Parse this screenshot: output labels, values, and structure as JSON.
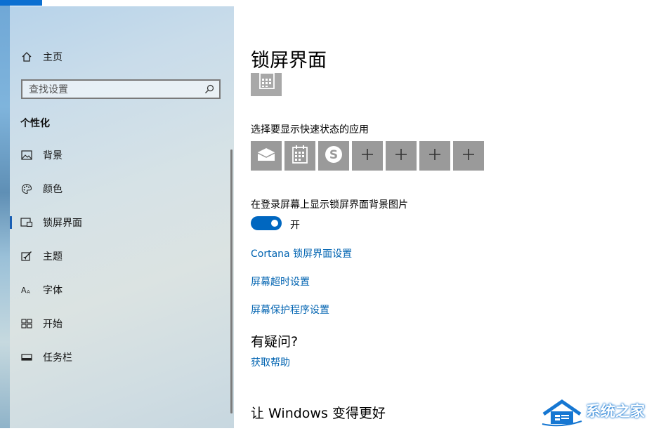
{
  "sidebar": {
    "home_label": "主页",
    "search_placeholder": "查找设置",
    "section_title": "个性化",
    "items": [
      {
        "label": "背景",
        "icon": "picture-icon"
      },
      {
        "label": "颜色",
        "icon": "palette-icon"
      },
      {
        "label": "锁屏界面",
        "icon": "lock-screen-icon",
        "active": true
      },
      {
        "label": "主题",
        "icon": "theme-icon"
      },
      {
        "label": "字体",
        "icon": "font-icon"
      },
      {
        "label": "开始",
        "icon": "start-icon"
      },
      {
        "label": "任务栏",
        "icon": "taskbar-icon"
      }
    ]
  },
  "main": {
    "title": "锁屏界面",
    "quick_status_label": "选择要显示快速状态的应用",
    "quick_status_apps": [
      "mail-icon",
      "calendar-icon",
      "skype-icon",
      "plus-icon",
      "plus-icon",
      "plus-icon",
      "plus-icon"
    ],
    "show_bg_label": "在登录屏幕上显示锁屏界面背景图片",
    "toggle_state": "开",
    "links": [
      "Cortana 锁屏界面设置",
      "屏幕超时设置",
      "屏幕保护程序设置"
    ],
    "question_heading": "有疑问?",
    "help_link": "获取帮助",
    "improve_heading": "让 Windows 变得更好"
  },
  "watermark": {
    "text": "系统之家"
  },
  "colors": {
    "accent": "#0067c0",
    "link": "#0063b1",
    "tile": "#9a9a9a"
  }
}
